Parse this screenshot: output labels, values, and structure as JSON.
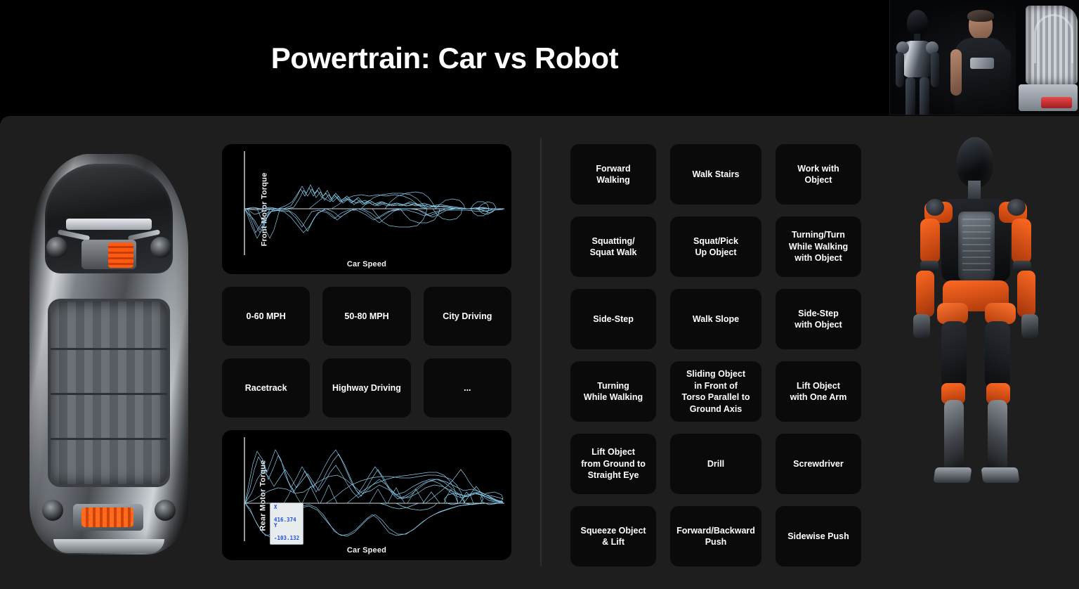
{
  "slide": {
    "title": "Powertrain: Car vs Robot"
  },
  "pip": {
    "label": "presenter-video-inset"
  },
  "car_panel": {
    "image_label": "electric-vehicle-chassis-top-view",
    "charts": [
      {
        "id": "front-motor-torque",
        "ylabel": "Front Motor Torque",
        "xlabel": "Car Speed",
        "tooltip": null
      },
      {
        "id": "rear-motor-torque",
        "ylabel": "Rear Motor Torque",
        "xlabel": "Car Speed",
        "tooltip": {
          "x_label": "X",
          "x_value": "416.374",
          "y_label": "Y",
          "y_value": "-103.132"
        }
      }
    ],
    "scenarios": [
      "0-60 MPH",
      "50-80 MPH",
      "City Driving",
      "Racetrack",
      "Highway Driving",
      "..."
    ]
  },
  "robot_panel": {
    "image_label": "humanoid-robot-front-view",
    "tasks": [
      "Forward\nWalking",
      "Walk Stairs",
      "Work with\nObject",
      "Squatting/\nSquat Walk",
      "Squat/Pick\nUp Object",
      "Turning/Turn\nWhile Walking\nwith Object",
      "Side-Step",
      "Walk Slope",
      "Side-Step\nwith Object",
      "Turning\nWhile Walking",
      "Sliding Object\nin Front of\nTorso Parallel to\nGround Axis",
      "Lift Object\nwith One Arm",
      "Lift Object\nfrom Ground to\nStraight Eye",
      "Drill",
      "Screwdriver",
      "Squeeze Object\n& Lift",
      "Forward/Backward\nPush",
      "Sidewise Push"
    ]
  },
  "chart_data": [
    {
      "type": "line",
      "id": "front-motor-torque",
      "title": "",
      "xlabel": "Car Speed",
      "ylabel": "Front Motor Torque",
      "grid": false,
      "legend": null,
      "axis_style": "two-axis-lines-no-ticks",
      "trace_color": "#8fd4f5",
      "description": "Dense overlaid scatter-trace envelope of front motor torque versus car speed; torque concentrated near the zero baseline with a positive-torque cluster at low-to-mid speed and a negative lobe at very low speed, decaying to near zero at high speed.",
      "zero_baseline_y": 0,
      "x_range": [
        0,
        1
      ],
      "y_range": [
        -1,
        1
      ],
      "envelope": {
        "x": [
          0.0,
          0.05,
          0.1,
          0.15,
          0.2,
          0.25,
          0.3,
          0.35,
          0.4,
          0.45,
          0.5,
          0.55,
          0.6,
          0.65,
          0.7,
          0.75,
          0.8,
          0.85,
          0.9,
          0.95,
          1.0
        ],
        "upper": [
          0.05,
          0.08,
          0.1,
          0.12,
          0.16,
          0.42,
          0.52,
          0.46,
          0.44,
          0.4,
          0.38,
          0.34,
          0.3,
          0.26,
          0.2,
          0.14,
          0.1,
          0.08,
          0.05,
          0.02,
          0.01
        ],
        "lower": [
          -0.62,
          -0.55,
          -0.4,
          -0.3,
          -0.26,
          -0.24,
          -0.22,
          -0.22,
          -0.28,
          -0.3,
          -0.26,
          -0.22,
          -0.2,
          -0.18,
          -0.14,
          -0.1,
          -0.08,
          -0.06,
          -0.04,
          -0.02,
          -0.01
        ]
      }
    },
    {
      "type": "line",
      "id": "rear-motor-torque",
      "title": "",
      "xlabel": "Car Speed",
      "ylabel": "Rear Motor Torque",
      "grid": false,
      "legend": null,
      "axis_style": "two-axis-lines-no-ticks",
      "trace_color": "#8fd4f5",
      "description": "Dense overlaid trace envelope of rear motor torque versus car speed; much larger positive torque excursions than the front motor, peaking at low speed and decaying with speed, plus a deep negative regeneration lobe in the low-to-mid speed range.",
      "zero_baseline_y": 0,
      "x_range": [
        0,
        1
      ],
      "y_range": [
        -1,
        1
      ],
      "cursor_readout": {
        "x": 416.374,
        "y": -103.132
      },
      "envelope": {
        "x": [
          0.0,
          0.05,
          0.1,
          0.15,
          0.2,
          0.25,
          0.3,
          0.35,
          0.4,
          0.45,
          0.5,
          0.55,
          0.6,
          0.65,
          0.7,
          0.75,
          0.8,
          0.85,
          0.9,
          0.95,
          1.0
        ],
        "upper": [
          0.1,
          0.74,
          0.86,
          0.6,
          0.52,
          0.66,
          0.88,
          0.7,
          0.52,
          0.46,
          0.42,
          0.44,
          0.46,
          0.4,
          0.34,
          0.42,
          0.3,
          0.24,
          0.22,
          0.18,
          0.06
        ],
        "lower": [
          -0.1,
          -0.3,
          -0.62,
          -0.66,
          -0.66,
          -0.64,
          -0.6,
          -0.58,
          -0.54,
          -0.4,
          -0.26,
          -0.2,
          -0.16,
          -0.1,
          -0.06,
          -0.04,
          -0.03,
          -0.02,
          -0.02,
          -0.01,
          0.0
        ]
      }
    }
  ]
}
